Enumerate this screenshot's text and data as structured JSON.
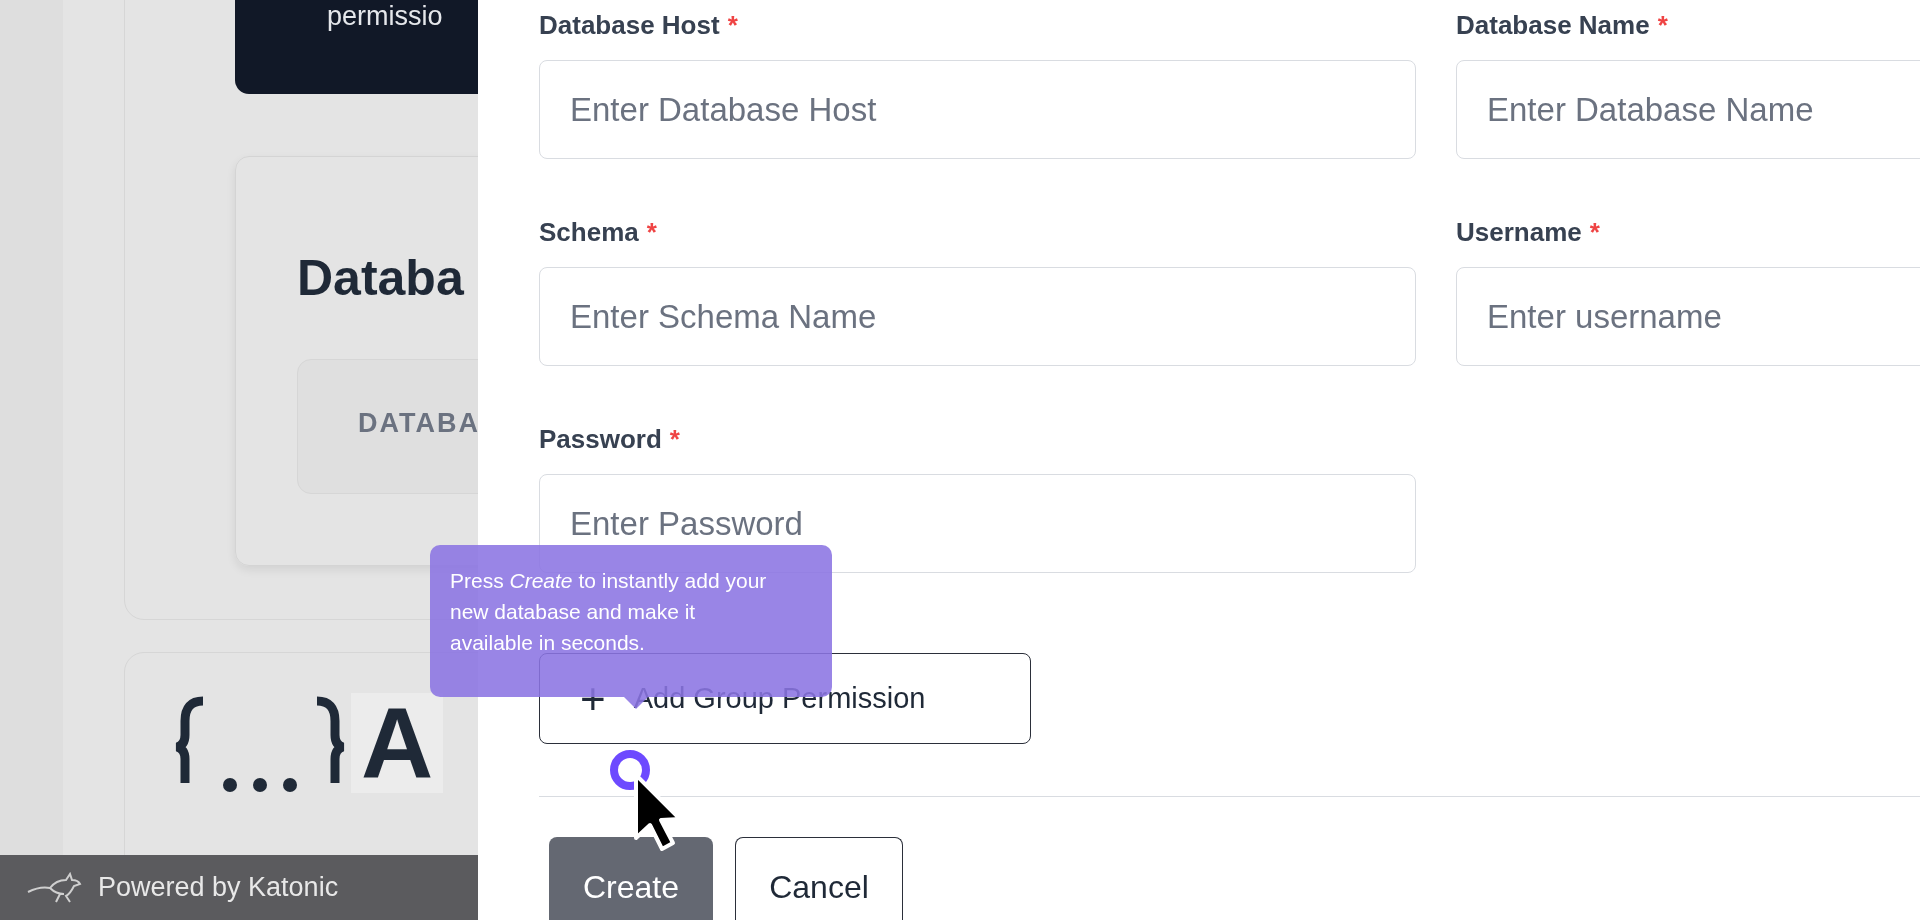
{
  "background": {
    "banner": {
      "text": "permissio"
    },
    "card": {
      "heading": "Databa",
      "tab": "DATABA"
    },
    "next_card": {
      "heading": "A"
    },
    "footer": {
      "text": "Powered by Katonic"
    }
  },
  "form": {
    "fields": [
      {
        "label": "Database Host",
        "marker": "*",
        "placeholder": "Enter Database Host"
      },
      {
        "label": "Database Name",
        "marker": "*",
        "placeholder": "Enter Database Name"
      },
      {
        "label": "Schema",
        "marker": "*",
        "placeholder": "Enter Schema Name"
      },
      {
        "label": "Username",
        "marker": "*",
        "placeholder": "Enter username"
      },
      {
        "label": "Password",
        "marker": "*",
        "placeholder": "Enter Password"
      }
    ],
    "add_button": {
      "icon": "+",
      "label": "Add Group Permission"
    },
    "buttons": [
      {
        "label": "Create",
        "kind": "primary"
      },
      {
        "label": "Cancel",
        "kind": "secondary"
      }
    ]
  },
  "tooltip": {
    "text": "Press *Create* to instantly add your new database and make it available in seconds."
  }
}
